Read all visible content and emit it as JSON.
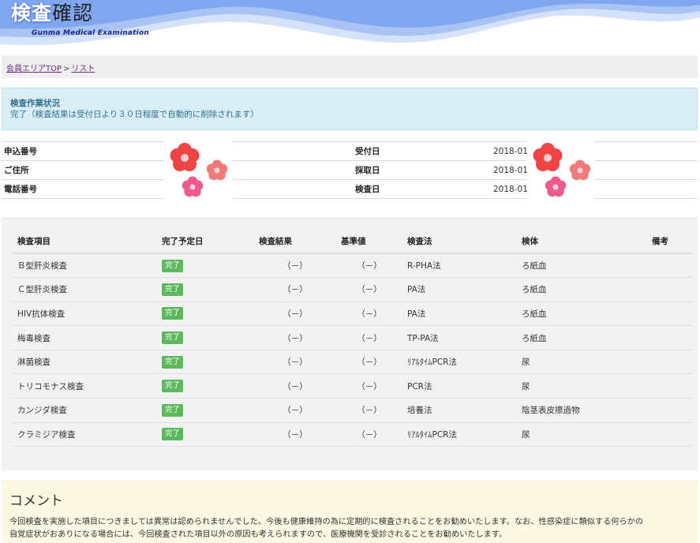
{
  "header": {
    "title_strong": "検査",
    "title_light": "確認",
    "subtitle": "Gunma Medical Examination",
    "wave_colors": [
      "#7fa6ee",
      "#a9c3f5",
      "#d5e2fb"
    ]
  },
  "breadcrumb": {
    "home": "会員エリアTOP",
    "separator": ">",
    "current": "リスト"
  },
  "status": {
    "title": "検査作業状況",
    "text": "完了（検査結果は受付日より３０日程度で自動的に削除されます）"
  },
  "info": [
    {
      "label": "申込番号",
      "value": "",
      "label2": "受付日",
      "value2": "2018-01-"
    },
    {
      "label": "ご住所",
      "value": "",
      "label2": "採取日",
      "value2": "2018-01-"
    },
    {
      "label": "電話番号",
      "value": "",
      "label2": "検査日",
      "value2": "2018-01-"
    }
  ],
  "results": {
    "headers": [
      "検査項目",
      "完了予定日",
      "検査結果",
      "基準値",
      "検査法",
      "検体",
      "備考"
    ],
    "rows": [
      {
        "item": "Ｂ型肝炎検査",
        "status": "完了",
        "result": "（－）",
        "standard": "（－）",
        "method": "R-PHA法",
        "specimen": "ろ紙血",
        "note": ""
      },
      {
        "item": "Ｃ型肝炎検査",
        "status": "完了",
        "result": "（－）",
        "standard": "（－）",
        "method": "PA法",
        "specimen": "ろ紙血",
        "note": ""
      },
      {
        "item": "HIV抗体検査",
        "status": "完了",
        "result": "（－）",
        "standard": "（－）",
        "method": "PA法",
        "specimen": "ろ紙血",
        "note": ""
      },
      {
        "item": "梅毒検査",
        "status": "完了",
        "result": "（－）",
        "standard": "（－）",
        "method": "TP-PA法",
        "specimen": "ろ紙血",
        "note": ""
      },
      {
        "item": "淋菌検査",
        "status": "完了",
        "result": "（－）",
        "standard": "（－）",
        "method": "ﾘｱﾙﾀｲﾑPCR法",
        "specimen": "尿",
        "note": ""
      },
      {
        "item": "トリコモナス検査",
        "status": "完了",
        "result": "（－）",
        "standard": "（－）",
        "method": "PCR法",
        "specimen": "尿",
        "note": ""
      },
      {
        "item": "カンジダ検査",
        "status": "完了",
        "result": "（－）",
        "standard": "（－）",
        "method": "培養法",
        "specimen": "陰茎表皮擦過物",
        "note": ""
      },
      {
        "item": "クラミジア検査",
        "status": "完了",
        "result": "（－）",
        "standard": "（－）",
        "method": "ﾘｱﾙﾀｲﾑPCR法",
        "specimen": "尿",
        "note": ""
      }
    ]
  },
  "comment": {
    "title": "コメント",
    "line1": "今回検査を実施した項目につきましては異常は認められませんでした。今後も健康維持の為に定期的に検査されることをお勧めいたします。なお、性感染症に類似する何らかの",
    "line2": "自覚症状がおありになる場合には、今回検査された項目以外の原因も考えられますので、医療機関を受診されることをお勧めいたします。"
  },
  "colors": {
    "status_bg": "#d9eef7",
    "status_text": "#31708f",
    "badge": "#5cb85c",
    "comment_bg": "#fcf8e3",
    "link": "#6a2a8a"
  }
}
